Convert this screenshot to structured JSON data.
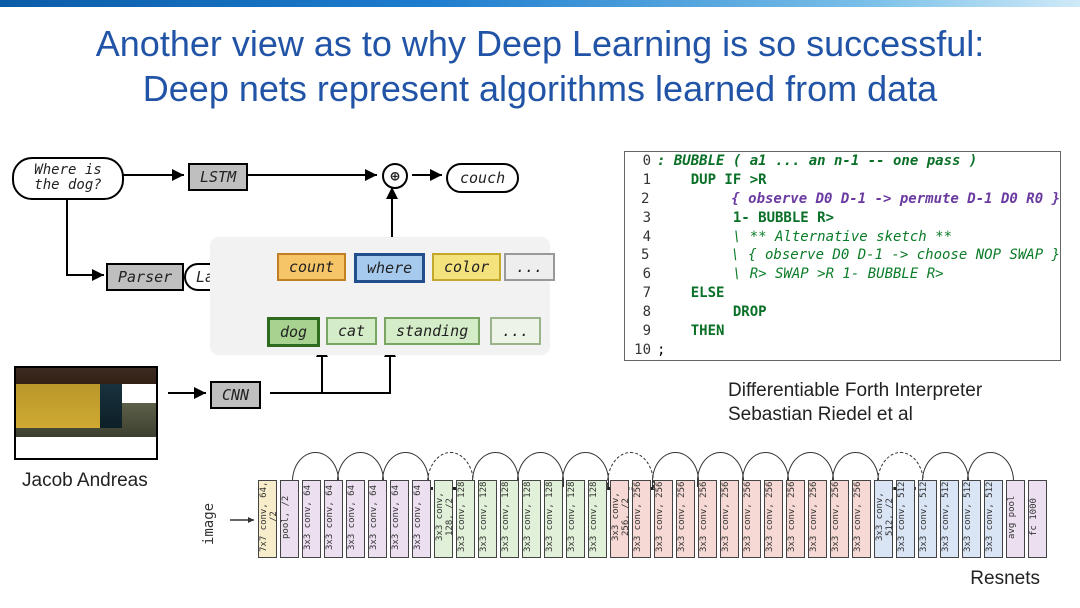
{
  "slide": {
    "title_line1": "Another view as to why Deep Learning is so successful:",
    "title_line2": "Deep nets represent algorithms learned from data"
  },
  "left": {
    "question": "Where is\nthe dog?",
    "lstm": "LSTM",
    "parser": "Parser",
    "layout": "Layout",
    "cnn": "CNN",
    "answer": "couch",
    "row1": [
      "count",
      "where",
      "color",
      "..."
    ],
    "row2": [
      "dog",
      "cat",
      "standing",
      "..."
    ],
    "caption": "Jacob Andreas"
  },
  "code": {
    "lines": [
      {
        "n": "0",
        "txt": ": BUBBLE ( a1 ... an n-1 -- one pass )",
        "cls": "kw em"
      },
      {
        "n": "1",
        "txt": "    DUP IF >R",
        "cls": "kw"
      },
      {
        "n": "2",
        "txt": "         { observe D0 D-1 -> permute D-1 D0 R0 }",
        "cls": "kw2 em"
      },
      {
        "n": "3",
        "txt": "         1- BUBBLE R>",
        "cls": "kw"
      },
      {
        "n": "4",
        "txt": "         \\ ** Alternative sketch **",
        "cls": "cmt"
      },
      {
        "n": "5",
        "txt": "         \\ { observe D0 D-1 -> choose NOP SWAP }",
        "cls": "cmt"
      },
      {
        "n": "6",
        "txt": "         \\ R> SWAP >R 1- BUBBLE R>",
        "cls": "cmt"
      },
      {
        "n": "7",
        "txt": "    ELSE",
        "cls": "kw"
      },
      {
        "n": "8",
        "txt": "         DROP",
        "cls": "kw"
      },
      {
        "n": "9",
        "txt": "    THEN",
        "cls": "kw"
      },
      {
        "n": "10",
        "txt": ";",
        "cls": ""
      }
    ],
    "caption1": "Differentiable Forth Interpreter",
    "caption2": "Sebastian Riedel et al"
  },
  "resnet": {
    "input": "image",
    "output": "fc 1000",
    "avgpool": "avg pool",
    "caption": "Resnets",
    "blocks": [
      {
        "t": "7x7 conv, 64, /2",
        "c": "rn-y"
      },
      {
        "t": "pool, /2",
        "c": "rn-p"
      },
      {
        "t": "3x3 conv, 64",
        "c": "rn-p"
      },
      {
        "t": "3x3 conv, 64",
        "c": "rn-p"
      },
      {
        "t": "3x3 conv, 64",
        "c": "rn-p"
      },
      {
        "t": "3x3 conv, 64",
        "c": "rn-p"
      },
      {
        "t": "3x3 conv, 64",
        "c": "rn-p"
      },
      {
        "t": "3x3 conv, 64",
        "c": "rn-p"
      },
      {
        "t": "3x3 conv, 128, /2",
        "c": "rn-g"
      },
      {
        "t": "3x3 conv, 128",
        "c": "rn-g"
      },
      {
        "t": "3x3 conv, 128",
        "c": "rn-g"
      },
      {
        "t": "3x3 conv, 128",
        "c": "rn-g"
      },
      {
        "t": "3x3 conv, 128",
        "c": "rn-g"
      },
      {
        "t": "3x3 conv, 128",
        "c": "rn-g"
      },
      {
        "t": "3x3 conv, 128",
        "c": "rn-g"
      },
      {
        "t": "3x3 conv, 128",
        "c": "rn-g"
      },
      {
        "t": "3x3 conv, 256, /2",
        "c": "rn-r"
      },
      {
        "t": "3x3 conv, 256",
        "c": "rn-r"
      },
      {
        "t": "3x3 conv, 256",
        "c": "rn-r"
      },
      {
        "t": "3x3 conv, 256",
        "c": "rn-r"
      },
      {
        "t": "3x3 conv, 256",
        "c": "rn-r"
      },
      {
        "t": "3x3 conv, 256",
        "c": "rn-r"
      },
      {
        "t": "3x3 conv, 256",
        "c": "rn-r"
      },
      {
        "t": "3x3 conv, 256",
        "c": "rn-r"
      },
      {
        "t": "3x3 conv, 256",
        "c": "rn-r"
      },
      {
        "t": "3x3 conv, 256",
        "c": "rn-r"
      },
      {
        "t": "3x3 conv, 256",
        "c": "rn-r"
      },
      {
        "t": "3x3 conv, 256",
        "c": "rn-r"
      },
      {
        "t": "3x3 conv, 512, /2",
        "c": "rn-b"
      },
      {
        "t": "3x3 conv, 512",
        "c": "rn-b"
      },
      {
        "t": "3x3 conv, 512",
        "c": "rn-b"
      },
      {
        "t": "3x3 conv, 512",
        "c": "rn-b"
      },
      {
        "t": "3x3 conv, 512",
        "c": "rn-b"
      },
      {
        "t": "3x3 conv, 512",
        "c": "rn-b"
      }
    ]
  }
}
